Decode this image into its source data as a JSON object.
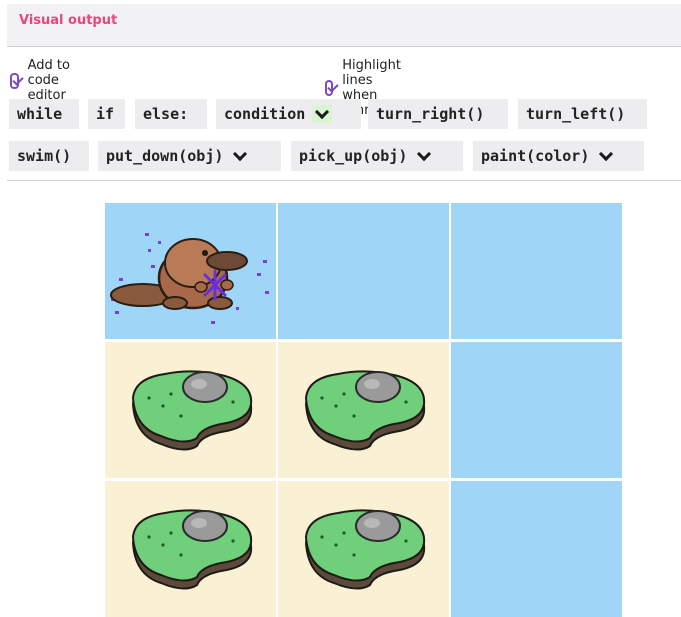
{
  "panel": {
    "title": "Visual output"
  },
  "options": [
    {
      "label": "Add to code editor",
      "checked": true
    },
    {
      "label": "Highlight lines when running",
      "checked": true
    }
  ],
  "blocks": {
    "row1": [
      "while",
      "if",
      "else:",
      "condition",
      "turn_right()",
      "turn_left()"
    ],
    "row2": [
      "swim()",
      "put_down(obj)",
      "pick_up(obj)",
      "paint(color)"
    ]
  },
  "colors": {
    "title": "#e8467c",
    "checkbox": "#7a48c8",
    "water": "#9fd6f8",
    "sand": "#faf1d5",
    "island_grass": "#6fcf7a"
  },
  "grid": {
    "rows": 3,
    "cols": 3,
    "cells": [
      [
        "water-platypus",
        "water",
        "water"
      ],
      [
        "sand-island",
        "sand-island",
        "water"
      ],
      [
        "sand-island",
        "sand-island",
        "water"
      ]
    ]
  }
}
